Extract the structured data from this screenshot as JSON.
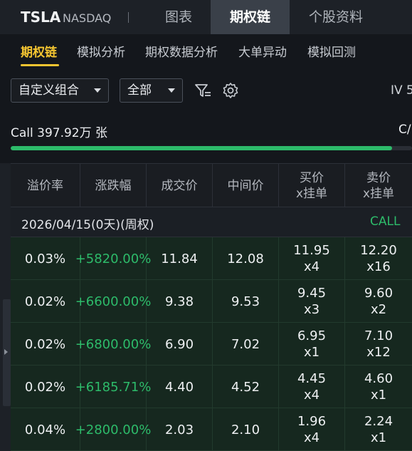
{
  "header": {
    "ticker": "TSLA",
    "exchange": "NASDAQ",
    "tabs": [
      "图表",
      "期权链",
      "个股资料"
    ],
    "active_tab": "期权链"
  },
  "subtabs": [
    "期权链",
    "模拟分析",
    "期权数据分析",
    "大单异动",
    "模拟回测"
  ],
  "filters": {
    "combo": "自定义组合",
    "range": "全部",
    "iv_label": "IV 5"
  },
  "volume": {
    "call_text": "Call 397.92万 张",
    "right_text": "C/",
    "call_fraction": 0.95
  },
  "table": {
    "headers": [
      {
        "line1": "溢价率",
        "line2": ""
      },
      {
        "line1": "涨跌幅",
        "line2": ""
      },
      {
        "line1": "成交价",
        "line2": ""
      },
      {
        "line1": "中间价",
        "line2": ""
      },
      {
        "line1": "买价",
        "line2": "x挂单"
      },
      {
        "line1": "卖价",
        "line2": "x挂单"
      }
    ],
    "expiry": "2026/04/15(0天)(周权)",
    "side_label": "CALL",
    "rows": [
      {
        "premium": "0.03%",
        "change": "+5820.00%",
        "last": "11.84",
        "mid": "12.08",
        "bid": "11.95",
        "bid_size": "x4",
        "ask": "12.20",
        "ask_size": "x16"
      },
      {
        "premium": "0.02%",
        "change": "+6600.00%",
        "last": "9.38",
        "mid": "9.53",
        "bid": "9.45",
        "bid_size": "x3",
        "ask": "9.60",
        "ask_size": "x2"
      },
      {
        "premium": "0.02%",
        "change": "+6800.00%",
        "last": "6.90",
        "mid": "7.02",
        "bid": "6.95",
        "bid_size": "x1",
        "ask": "7.10",
        "ask_size": "x12"
      },
      {
        "premium": "0.02%",
        "change": "+6185.71%",
        "last": "4.40",
        "mid": "4.52",
        "bid": "4.45",
        "bid_size": "x4",
        "ask": "4.60",
        "ask_size": "x1"
      },
      {
        "premium": "0.04%",
        "change": "+2800.00%",
        "last": "2.03",
        "mid": "2.10",
        "bid": "1.96",
        "bid_size": "x4",
        "ask": "2.24",
        "ask_size": "x1"
      }
    ]
  },
  "colors": {
    "accent": "#f4c531",
    "up": "#2dbb6a"
  },
  "icons": {
    "filter": "filter-icon",
    "settings": "gear-icon"
  }
}
